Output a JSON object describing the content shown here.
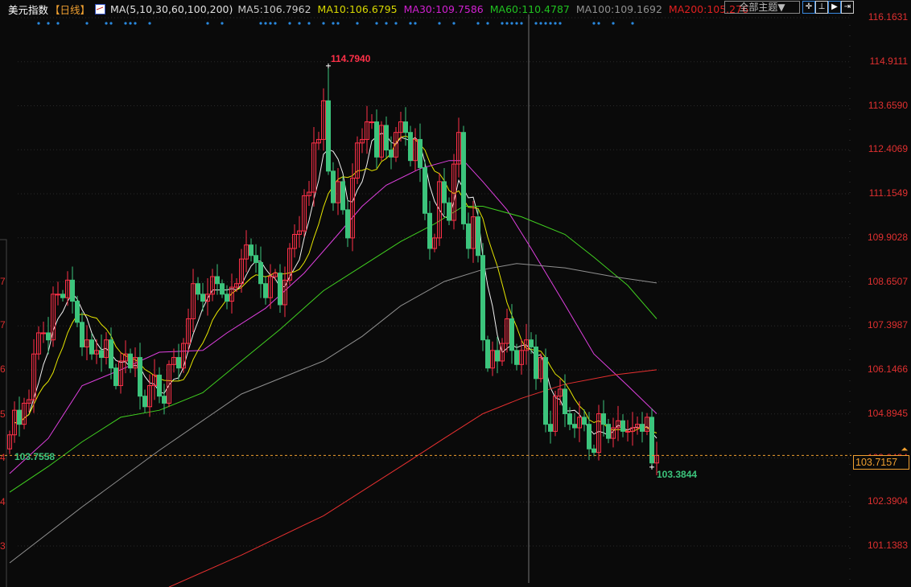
{
  "header": {
    "instrument": "美元指数",
    "period": "【日线】",
    "ma_params": "MA(5,10,30,60,100,200)",
    "ma_values": [
      {
        "label": "MA5:106.7962",
        "color": "#c8c8c8"
      },
      {
        "label": "MA10:106.6795",
        "color": "#d8d800"
      },
      {
        "label": "MA30:109.7586",
        "color": "#d020d0"
      },
      {
        "label": "MA60:110.4787",
        "color": "#20c020"
      },
      {
        "label": "MA100:109.1692",
        "color": "#909090"
      },
      {
        "label": "MA200:105.276",
        "color": "#e02020"
      }
    ]
  },
  "toolbar": {
    "topic_button": "全部主题▼",
    "icons": [
      "crosshair-icon",
      "fit-range-icon",
      "play-step-icon",
      "move-right-icon"
    ]
  },
  "chart_data": {
    "type": "candlestick",
    "y_axis_ticks": [
      "116.1631",
      "114.9111",
      "113.6590",
      "112.4069",
      "111.1549",
      "109.9028",
      "108.6507",
      "107.3987",
      "106.1466",
      "104.8945",
      "103.6424",
      "102.3904",
      "101.1383"
    ],
    "ylim": [
      99.9,
      116.4
    ],
    "left_axis_fragments": [
      "7",
      "7",
      "6",
      "5",
      "4",
      "4",
      "3"
    ],
    "up_color": "#ff3048",
    "down_color": "#3cc47c",
    "close": [
      104.3,
      105.0,
      104.6,
      105.2,
      105.3,
      106.6,
      107.2,
      107.2,
      107.0,
      108.3,
      108.3,
      108.2,
      108.7,
      108.1,
      107.5,
      106.8,
      107.0,
      106.6,
      106.7,
      106.5,
      107.0,
      106.2,
      105.7,
      106.4,
      106.6,
      106.2,
      106.5,
      105.4,
      105.1,
      105.7,
      106.0,
      105.4,
      105.2,
      106.3,
      106.5,
      106.2,
      106.9,
      107.6,
      108.6,
      108.3,
      108.1,
      108.3,
      108.8,
      108.6,
      108.3,
      108.1,
      108.5,
      108.6,
      109.3,
      109.7,
      109.4,
      109.2,
      108.6,
      108.2,
      108.8,
      108.9,
      108.0,
      108.7,
      109.6,
      110.0,
      110.1,
      111.1,
      111.2,
      112.6,
      112.7,
      113.8,
      111.8,
      110.9,
      111.5,
      110.7,
      109.9,
      111.6,
      112.6,
      112.7,
      113.2,
      113.2,
      112.2,
      113.1,
      112.4,
      112.2,
      112.9,
      113.2,
      112.9,
      112.1,
      112.7,
      111.9,
      110.6,
      109.6,
      109.9,
      111.5,
      110.9,
      110.4,
      112.0,
      112.9,
      110.3,
      109.6,
      110.5,
      109.4,
      107.0,
      106.2,
      106.7,
      106.4,
      106.9,
      107.6,
      106.7,
      106.3,
      106.7,
      107.0,
      106.8,
      105.9,
      106.5,
      104.6,
      104.4,
      105.4,
      105.6,
      104.9,
      104.6,
      104.5,
      104.8,
      104.6,
      103.9,
      103.8,
      104.9,
      104.6,
      104.2,
      104.5,
      104.7,
      104.4,
      104.4,
      104.5,
      104.6,
      104.4,
      104.8,
      103.5,
      103.7157
    ],
    "first_open": 103.9,
    "high_marker": {
      "label": "114.7940",
      "value": 114.794,
      "index": 66
    },
    "low_marker": {
      "label": "103.3844",
      "value": 103.3844,
      "index": 133
    },
    "left_low_marker": {
      "label": "103.7558",
      "value": 103.7558,
      "index": 0
    },
    "current_price": {
      "label": "103.7157",
      "value": 103.7157
    },
    "crosshair_index": 107.5,
    "signal_indices": [
      6,
      8,
      10,
      16,
      20,
      21,
      24,
      25,
      26,
      29,
      41,
      44,
      52,
      53,
      54,
      55,
      58,
      60,
      62,
      65,
      67,
      68,
      72,
      76,
      78,
      80,
      83,
      84,
      89,
      92,
      97,
      99,
      102,
      103,
      104,
      105,
      106,
      109,
      110,
      111,
      112,
      113,
      114,
      121,
      122,
      125,
      129
    ],
    "signal_color": "#2a8ae0",
    "series": [
      {
        "name": "MA5",
        "period": 5,
        "color": "#f0f0f0"
      },
      {
        "name": "MA10",
        "period": 10,
        "color": "#e6e600"
      },
      {
        "name": "MA30",
        "color": "#e040e0",
        "points": [
          [
            0,
            103.2
          ],
          [
            8,
            104.2
          ],
          [
            15,
            105.7
          ],
          [
            23,
            106.15
          ],
          [
            31,
            106.65
          ],
          [
            40,
            106.7
          ],
          [
            45,
            107.2
          ],
          [
            53,
            107.9
          ],
          [
            61,
            108.9
          ],
          [
            68,
            110.0
          ],
          [
            73,
            110.8
          ],
          [
            78,
            111.4
          ],
          [
            85,
            111.87
          ],
          [
            91,
            112.1
          ],
          [
            94,
            112.1
          ],
          [
            98,
            111.5
          ],
          [
            103,
            110.7
          ],
          [
            108,
            109.6
          ],
          [
            115,
            108.0
          ],
          [
            121,
            106.6
          ],
          [
            128,
            105.7
          ],
          [
            134,
            104.9
          ]
        ]
      },
      {
        "name": "MA60",
        "color": "#40d020",
        "points": [
          [
            0,
            102.67
          ],
          [
            8,
            103.4
          ],
          [
            15,
            104.1
          ],
          [
            23,
            104.8
          ],
          [
            31,
            105.0
          ],
          [
            40,
            105.5
          ],
          [
            48,
            106.4
          ],
          [
            56,
            107.3
          ],
          [
            65,
            108.4
          ],
          [
            73,
            109.1
          ],
          [
            81,
            109.8
          ],
          [
            88,
            110.3
          ],
          [
            94,
            110.8
          ],
          [
            98,
            110.8
          ],
          [
            106,
            110.5
          ],
          [
            115,
            110.0
          ],
          [
            121,
            109.35
          ],
          [
            128,
            108.55
          ],
          [
            134,
            107.6
          ]
        ]
      },
      {
        "name": "MA100",
        "color": "#909090",
        "points": [
          [
            0,
            100.66
          ],
          [
            15,
            102.25
          ],
          [
            31,
            103.86
          ],
          [
            48,
            105.46
          ],
          [
            65,
            106.4
          ],
          [
            73,
            107.1
          ],
          [
            81,
            107.97
          ],
          [
            90,
            108.66
          ],
          [
            98,
            109.0
          ],
          [
            105,
            109.17
          ],
          [
            115,
            109.05
          ],
          [
            125,
            108.8
          ],
          [
            134,
            108.62
          ]
        ]
      },
      {
        "name": "MA200",
        "color": "#e83030",
        "points": [
          [
            33,
            99.97
          ],
          [
            48,
            100.88
          ],
          [
            65,
            102.0
          ],
          [
            81,
            103.4
          ],
          [
            90,
            104.2
          ],
          [
            98,
            104.9
          ],
          [
            106,
            105.34
          ],
          [
            115,
            105.74
          ],
          [
            125,
            106.0
          ],
          [
            134,
            106.15
          ]
        ]
      }
    ]
  }
}
